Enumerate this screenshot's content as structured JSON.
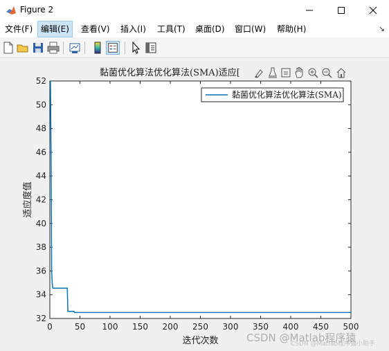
{
  "window": {
    "title": "Figure 2"
  },
  "menubar": {
    "items": [
      {
        "label": "文件(F)"
      },
      {
        "label": "编辑(E)"
      },
      {
        "label": "查看(V)"
      },
      {
        "label": "插入(I)"
      },
      {
        "label": "工具(T)"
      },
      {
        "label": "桌面(D)"
      },
      {
        "label": "窗口(W)"
      },
      {
        "label": "帮助(H)"
      }
    ],
    "active_item": "编辑(E)",
    "overflow_icon": "menu-overflow-arrow"
  },
  "toolbar": {
    "buttons": [
      "new-figure-icon",
      "open-file-icon",
      "save-icon",
      "print-icon",
      "link-plot-icon",
      "colorbar-icon",
      "legend-icon",
      "edit-plot-arrow-icon",
      "property-inspector-icon"
    ],
    "pressed": "legend-icon"
  },
  "axes_toolbar": {
    "buttons": [
      "brush-icon",
      "data-tips-icon",
      "save-axes-icon",
      "pan-icon",
      "zoom-in-icon",
      "zoom-out-icon",
      "home-icon"
    ]
  },
  "chart_data": {
    "type": "line",
    "title": "黏菌优化算法优化算法(SMA)适应度",
    "title_visible": "黏菌优化算法优化算法(SMA)适应[",
    "xlabel": "迭代次数",
    "ylabel": "适应度值",
    "xlim": [
      0,
      500
    ],
    "ylim": [
      32,
      52
    ],
    "xticks": [
      "0",
      "50",
      "100",
      "150",
      "200",
      "250",
      "300",
      "350",
      "400",
      "450",
      "500"
    ],
    "yticks": [
      "32",
      "34",
      "36",
      "38",
      "40",
      "42",
      "44",
      "46",
      "48",
      "50",
      "52"
    ],
    "grid": false,
    "legend_position": "top-right",
    "series": [
      {
        "name": "黏菌优化算法优化算法(SMA)",
        "color": "#0072bd",
        "x": [
          1,
          2,
          3,
          4,
          5,
          6,
          29,
          30,
          40,
          41,
          500
        ],
        "y": [
          52,
          46,
          36,
          34.9,
          34.55,
          34.55,
          34.55,
          32.6,
          32.6,
          32.5,
          32.5
        ]
      }
    ]
  },
  "watermark": {
    "text": "CSDN @Matlab程序猿",
    "small_text": "CSDN @Matlab程序猿小助手"
  }
}
